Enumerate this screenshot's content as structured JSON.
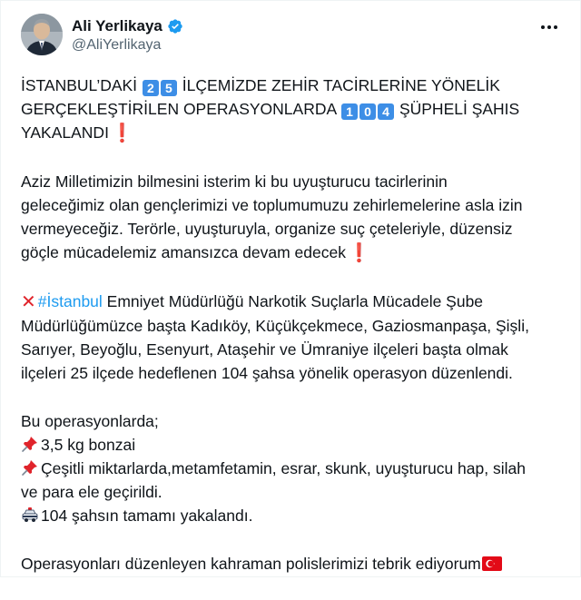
{
  "author": {
    "name": "Ali Yerlikaya",
    "handle": "@AliYerlikaya"
  },
  "tweet": {
    "p1": {
      "l1_a": "İSTANBUL’DAKİ",
      "l1_k1": "2",
      "l1_k2": "5",
      "l1_b": "İLÇEMİZDE ZEHİR TACİRLERİNE YÖNELİK",
      "l2_a": "GERÇEKLEŞTİRİLEN OPERASYONLARDA",
      "l2_k1": "1",
      "l2_k2": "0",
      "l2_k3": "4",
      "l2_b": "ŞÜPHELİ ŞAHIS",
      "l3": "YAKALANDI"
    },
    "p2": [
      "Aziz Milletimizin bilmesini isterim ki bu uyuşturucu tacirlerinin",
      "geleceğimiz olan gençlerimizi ve toplumumuzu zehirlemelerine asla izin",
      "vermeyeceğiz. Terörle, uyuşturuyla, organize suç çeteleriyle, düzensiz",
      "göçle mücadelemiz amansızca devam edecek"
    ],
    "p3": {
      "hashtag": "#İstanbul",
      "l1_rest": "Emniyet Müdürlüğü Narkotik Suçlarla Mücadele Şube",
      "l2": "Müdürlüğümüzce başta Kadıköy, Küçükçekmece, Gaziosmanpaşa, Şişli,",
      "l3": "Sarıyer, Beyoğlu, Esenyurt, Ataşehir ve Ümraniye ilçeleri başta olmak",
      "l4": "ilçeleri 25 ilçede hedeflenen 104 şahsa yönelik operasyon düzenlendi."
    },
    "p4": {
      "l1": "Bu operasyonlarda;",
      "l2": "3,5 kg bonzai",
      "l3": "Çeşitli miktarlarda,metamfetamin, esrar, skunk, uyuşturucu hap, silah",
      "l4": "ve para ele geçirildi.",
      "l5": "104 şahsın tamamı yakalandı."
    },
    "p5": "Operasyonları düzenleyen kahraman polislerimizi tebrik ediyorum"
  },
  "icons": {
    "verified": "verified-badge-icon",
    "more": "more-options-icon",
    "keycap": "keycap-digit-icon",
    "exclamation": "red-exclamation-icon",
    "cross": "red-cross-mark-icon",
    "pushpin": "pushpin-icon",
    "police_car": "police-car-icon",
    "flag": "turkey-flag-icon"
  },
  "colors": {
    "link": "#1d9bf0",
    "verified": "#1d9bf0",
    "text": "#0f1419",
    "secondary": "#536471",
    "keycap": "#3d8ee6",
    "alert": "#e0242b"
  }
}
